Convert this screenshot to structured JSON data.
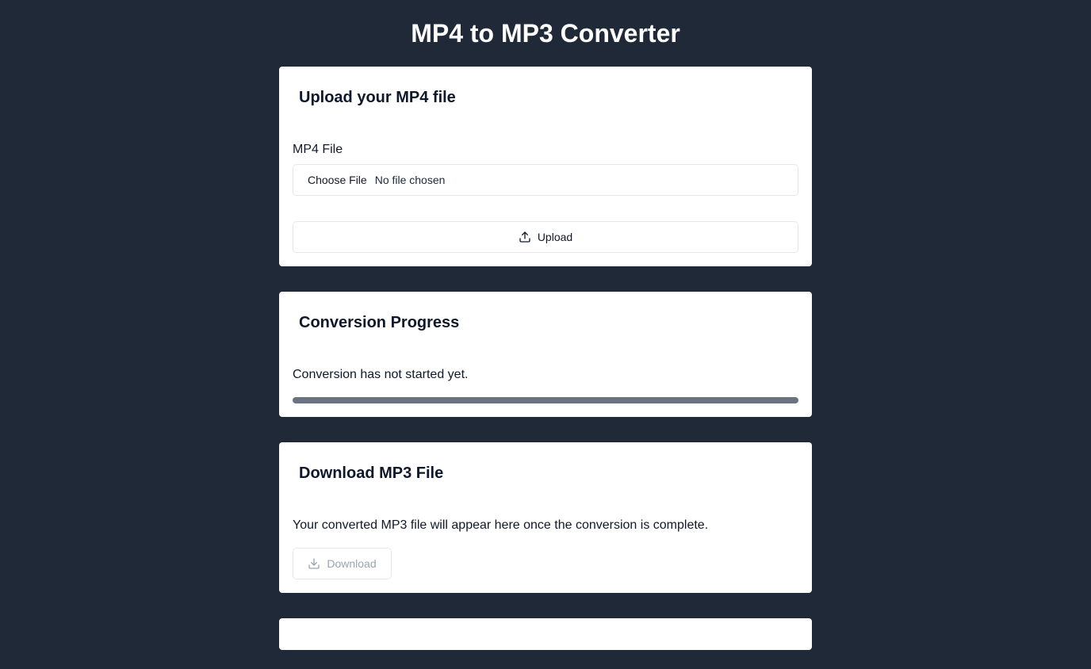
{
  "header": {
    "title": "MP4 to MP3 Converter"
  },
  "upload_card": {
    "title": "Upload your MP4 file",
    "field_label": "MP4 File",
    "choose_file_label": "Choose File",
    "file_status": "No file chosen",
    "upload_button_label": "Upload",
    "upload_icon": "upload-icon"
  },
  "progress_card": {
    "title": "Conversion Progress",
    "status_text": "Conversion has not started yet.",
    "progress_percent": 0
  },
  "download_card": {
    "title": "Download MP3 File",
    "description": "Your converted MP3 file will appear here once the conversion is complete.",
    "download_button_label": "Download",
    "download_button_disabled": true,
    "download_icon": "download-icon"
  },
  "colors": {
    "background": "#1f2937",
    "card": "#ffffff",
    "progress_track": "#6b7280",
    "disabled_text": "#9ca3af"
  }
}
